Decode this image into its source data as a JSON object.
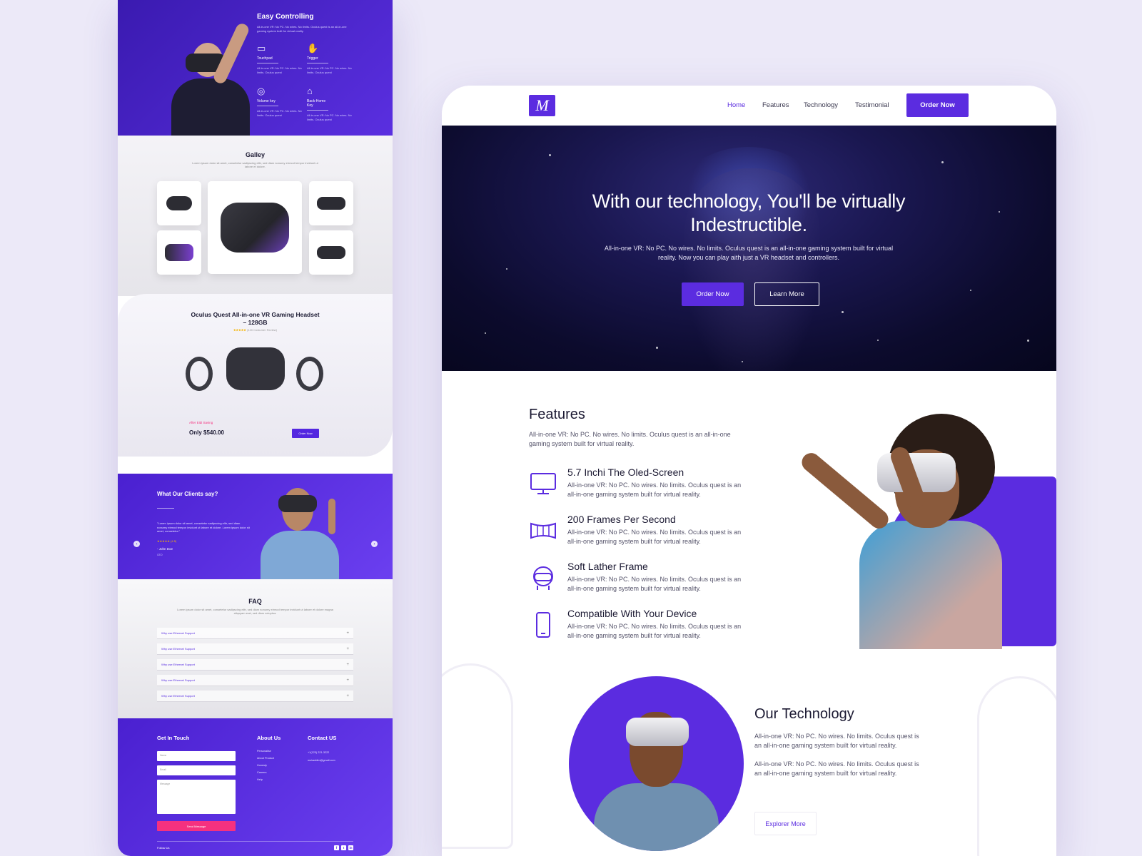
{
  "left": {
    "easy": {
      "title": "Easy Controlling",
      "subtitle": "All-in-one VR: No PC. No wires. No limits. Oculus quest is an all-in-one gaming system built for virtual reality.",
      "features": [
        {
          "name": "Touchpad",
          "desc": "All-in-one VR: No PC. No wires. No limits. Oculus quest",
          "icon": "touchpad-icon"
        },
        {
          "name": "Trigger",
          "desc": "All-in-one VR: No PC. No wires. No limits. Oculus quest",
          "icon": "hand-icon"
        },
        {
          "name": "Volume key",
          "desc": "All-in-one VR: No PC. No wires. No limits. Oculus quest",
          "icon": "gamepad-icon"
        },
        {
          "name": "Back-Home Key",
          "desc": "All-in-one VR: No PC. No wires. No limits. Oculus quest",
          "icon": "home-icon"
        }
      ]
    },
    "gallery": {
      "title": "Galley",
      "subtitle": "Lorem ipsum dolor sit amet, consetetur sadipscing elitr, sed diam nonumy eirmod tempor invidunt ut labore et dolore."
    },
    "product": {
      "title": "Oculus Quest All-in-one VR Gaming Headset – 128GB",
      "stars": "★★★★★",
      "reviews": "(120 Costumer Review)",
      "saving": "After Eidi Saving",
      "price": "Only $540.00",
      "order_label": "Order Now"
    },
    "clients": {
      "title": "What Our Clients say?",
      "quote": "\"Lorem ipsum dolor sit amet, consetetur sadipscing elitr, sed diam nonumy eirmod tempor invidunt ut labore et dolore. Lorem ipsum dolor sit amet, consetetur.\"",
      "stars": "★★★★★ (4.5)",
      "name": "- John Doe",
      "role": "CEO",
      "prev": "‹",
      "next": "›"
    },
    "faq": {
      "title": "FAQ",
      "subtitle": "Lorem ipsum dolor sit amet, consetetur sadipscing elitr, sed diam nonumy eirmod tempor invidunt ut labore et dolore magna aliquyam erat, sed diam voluptua.",
      "items": [
        "Why use Ethernet Support",
        "Why use Ethernet Support",
        "Why use Ethernet Support",
        "Why use Ethernet Support",
        "Why use Ethernet Support"
      ],
      "plus": "+"
    },
    "footer": {
      "get_in_touch": "Get In Touch",
      "name_placeholder": "Name",
      "email_placeholder": "Email",
      "message_placeholder": "Message",
      "send_label": "Send Message",
      "about_title": "About Us",
      "about_links": [
        "Personalise",
        "About Product",
        "Honesty",
        "Careers",
        "Help"
      ],
      "contact_title": "Contact US",
      "phone": "+1(123) 221-3222",
      "email": "mukaddim@gmail.com",
      "follow": "Follow Us",
      "social": [
        "f",
        "t",
        "in"
      ]
    }
  },
  "right": {
    "nav": {
      "logo": "M",
      "links": [
        "Home",
        "Features",
        "Technology",
        "Testimonial"
      ],
      "active": "Home",
      "order_label": "Order Now"
    },
    "hero": {
      "title": "With our technology, You'll be virtually Indestructible.",
      "desc": "All-in-one VR: No PC. No wires. No limits. Oculus quest is an all-in-one gaming system built for virtual reality. Now you can play aith just a VR headset and controllers.",
      "order_label": "Order Now",
      "learn_label": "Learn More"
    },
    "features": {
      "title": "Features",
      "intro": "All-in-one VR: No PC. No wires. No limits. Oculus quest is an all-in-one gaming system built for virtual reality.",
      "items": [
        {
          "title": "5.7 Inchi The Oled-Screen",
          "desc": "All-in-one VR: No PC. No wires. No limits. Oculus quest is an all-in-one gaming system built for virtual reality.",
          "icon": "monitor-icon"
        },
        {
          "title": "200 Frames Per Second",
          "desc": "All-in-one VR: No PC. No wires. No limits. Oculus quest is an all-in-one gaming system built for virtual reality.",
          "icon": "panorama-icon"
        },
        {
          "title": "Soft Lather Frame",
          "desc": "All-in-one VR: No PC. No wires. No limits. Oculus quest is an all-in-one gaming system built for virtual reality.",
          "icon": "vr-headset-icon"
        },
        {
          "title": "Compatible With Your Device",
          "desc": "All-in-one VR: No PC. No wires. No limits. Oculus quest is an all-in-one gaming system built for virtual reality.",
          "icon": "phone-icon"
        }
      ]
    },
    "technology": {
      "title": "Our Technology",
      "p1": "All-in-one VR: No PC. No wires. No limits. Oculus quest is an all-in-one gaming  system built for virtual reality.",
      "p2": "All-in-one VR: No PC. No wires. No limits. Oculus quest is an all-in-one gaming system built for virtual reality.",
      "explore_label": "Explorer More"
    }
  },
  "colors": {
    "brand": "#5b2ce0",
    "accent_pink": "#f5317f",
    "background": "#ece9f8",
    "hero_dark": "#0c0b2d"
  }
}
